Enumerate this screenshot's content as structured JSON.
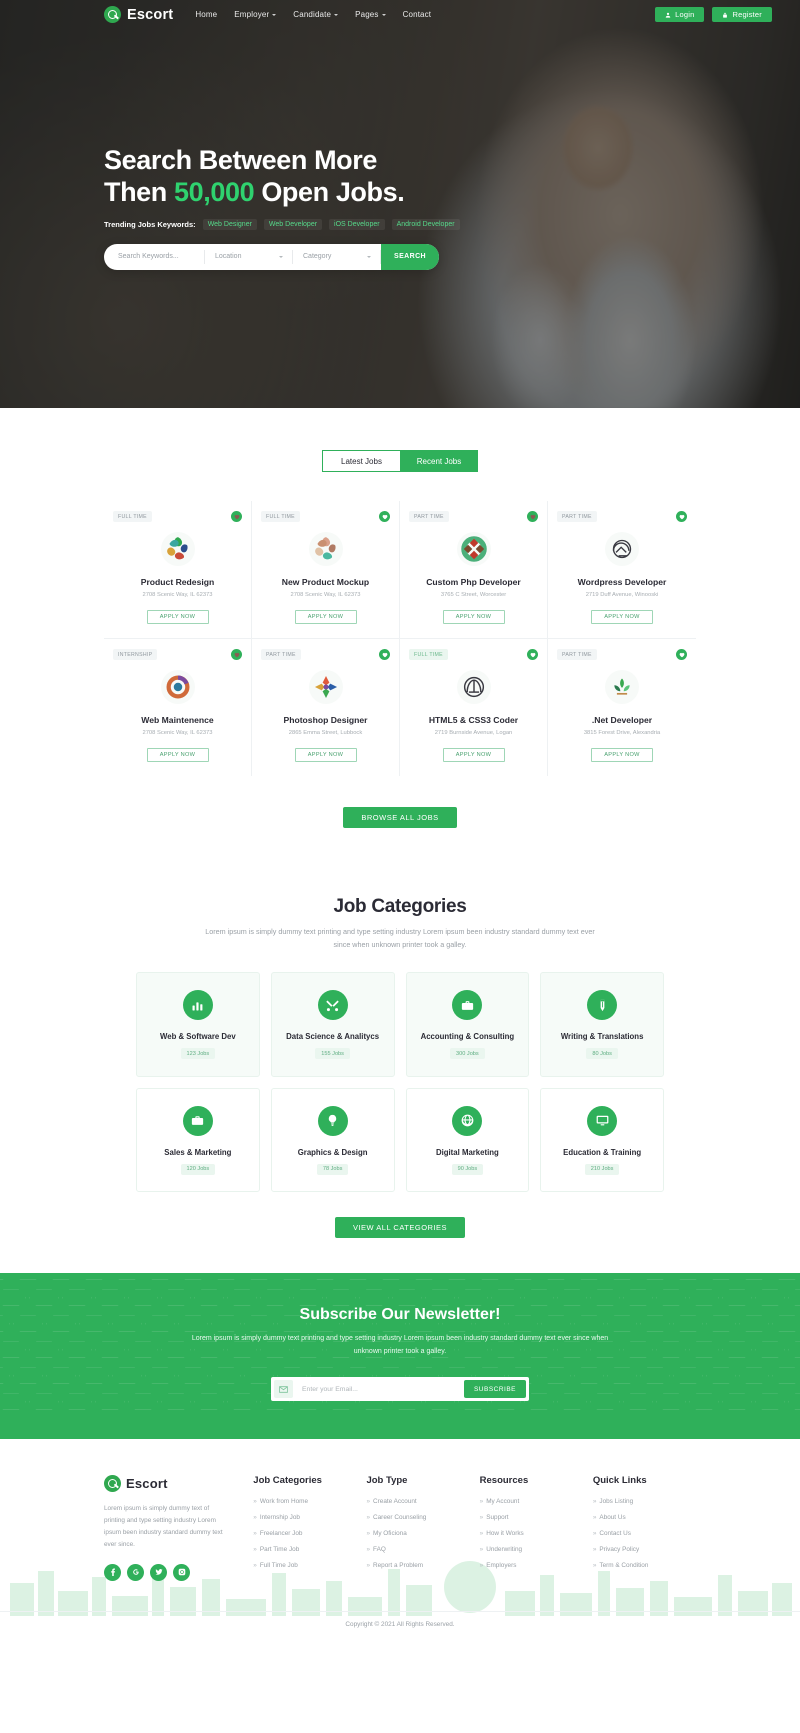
{
  "brand": {
    "name": "Escort"
  },
  "nav": {
    "links": [
      {
        "label": "Home",
        "caret": false
      },
      {
        "label": "Employer",
        "caret": true
      },
      {
        "label": "Candidate",
        "caret": true
      },
      {
        "label": "Pages",
        "caret": true
      },
      {
        "label": "Contact",
        "caret": false
      }
    ],
    "login": "Login",
    "register": "Register"
  },
  "hero": {
    "line1": "Search Between More",
    "line2_pre": "Then",
    "line2_hl": "50,000",
    "line2_post": "Open Jobs.",
    "trending_label": "Trending Jobs Keywords:",
    "tags": [
      "Web Designer",
      "Web Developer",
      "iOS Developer",
      "Android Developer"
    ],
    "search": {
      "keywords_placeholder": "Search Keywords...",
      "location_value": "Location",
      "category_value": "Category",
      "button": "SEARCH"
    }
  },
  "jobs": {
    "tabs": [
      {
        "label": "Latest Jobs",
        "active": false
      },
      {
        "label": "Recent Jobs",
        "active": true
      }
    ],
    "apply_label": "APPLY NOW",
    "browse_label": "BROWSE ALL JOBS",
    "items": [
      {
        "badge": "FULL TIME",
        "badge_green": false,
        "fav": "dim",
        "title": "Product Redesign",
        "address": "2708 Scenic Way, IL 62373"
      },
      {
        "badge": "FULL TIME",
        "badge_green": false,
        "fav": "green",
        "title": "New Product Mockup",
        "address": "2708 Scenic Way, IL 62373"
      },
      {
        "badge": "PART TIME",
        "badge_green": false,
        "fav": "dim",
        "title": "Custom Php Developer",
        "address": "3765 C Street, Worcester"
      },
      {
        "badge": "PART TIME",
        "badge_green": false,
        "fav": "green",
        "title": "Wordpress Developer",
        "address": "2719 Duff Avenue, Winooski"
      },
      {
        "badge": "INTERNSHIP",
        "badge_green": false,
        "fav": "dim",
        "title": "Web Maintenence",
        "address": "2708 Scenic Way, IL 62373"
      },
      {
        "badge": "PART TIME",
        "badge_green": false,
        "fav": "green",
        "title": "Photoshop Designer",
        "address": "2865 Emma Street, Lubbock"
      },
      {
        "badge": "FULL TIME",
        "badge_green": true,
        "fav": "green",
        "title": "HTML5 & CSS3 Coder",
        "address": "2719 Burnside Avenue, Logan"
      },
      {
        "badge": "PART TIME",
        "badge_green": false,
        "fav": "green",
        "title": ".Net Developer",
        "address": "3815 Forest Drive, Alexandria"
      }
    ]
  },
  "categories": {
    "title": "Job Categories",
    "subtitle": "Lorem ipsum is simply dummy text printing and type setting industry Lorem ipsum been industry standard dummy text ever since when unknown printer took a galley.",
    "view_all": "VIEW ALL CATEGORIES",
    "items": [
      {
        "icon": "bar-chart-icon",
        "name": "Web & Software Dev",
        "count": "123 Jobs",
        "tinted": true
      },
      {
        "icon": "tools-icon",
        "name": "Data Science & Analitycs",
        "count": "155 Jobs",
        "tinted": true
      },
      {
        "icon": "briefcase-icon",
        "name": "Accounting & Consulting",
        "count": "300 Jobs",
        "tinted": true
      },
      {
        "icon": "pen-icon",
        "name": "Writing & Translations",
        "count": "80 Jobs",
        "tinted": true
      },
      {
        "icon": "bag-icon",
        "name": "Sales & Marketing",
        "count": "120 Jobs",
        "tinted": false
      },
      {
        "icon": "bulb-icon",
        "name": "Graphics & Design",
        "count": "78 Jobs",
        "tinted": false
      },
      {
        "icon": "globe-icon",
        "name": "Digital Marketing",
        "count": "90 Jobs",
        "tinted": false
      },
      {
        "icon": "monitor-icon",
        "name": "Education & Training",
        "count": "210 Jobs",
        "tinted": false
      }
    ]
  },
  "newsletter": {
    "title": "Subscribe Our Newsletter!",
    "subtitle": "Lorem ipsum is simply dummy text printing and type setting industry Lorem ipsum been industry standard dummy text ever since when unknown printer took a galley.",
    "placeholder": "Enter your Email...",
    "button": "SUBSCRIBE"
  },
  "footer": {
    "about": "Lorem ipsum is simply dummy text of printing and type setting industry Lorem ipsum been industry standard dummy text ever since.",
    "socials": [
      "facebook-icon",
      "google-icon",
      "twitter-icon",
      "instagram-icon"
    ],
    "columns": [
      {
        "heading": "Job Categories",
        "links": [
          "Work from Home",
          "Internship Job",
          "Freelancer Job",
          "Part Time Job",
          "Full Time Job"
        ]
      },
      {
        "heading": "Job Type",
        "links": [
          "Create Account",
          "Career Counseling",
          "My Oficiona",
          "FAQ",
          "Report a Problem"
        ]
      },
      {
        "heading": "Resources",
        "links": [
          "My Account",
          "Support",
          "How it Works",
          "Underwriting",
          "Employers"
        ]
      },
      {
        "heading": "Quick Links",
        "links": [
          "Jobs Listing",
          "About Us",
          "Contact Us",
          "Privacy Policy",
          "Term & Condition"
        ]
      }
    ],
    "copyright": "Copyright © 2021 All Rights Reserved."
  },
  "colors": {
    "accent": "#2fb05a",
    "accent_bright": "#2fd26f",
    "dark": "#2b2b35",
    "muted": "#9aa0a6"
  }
}
